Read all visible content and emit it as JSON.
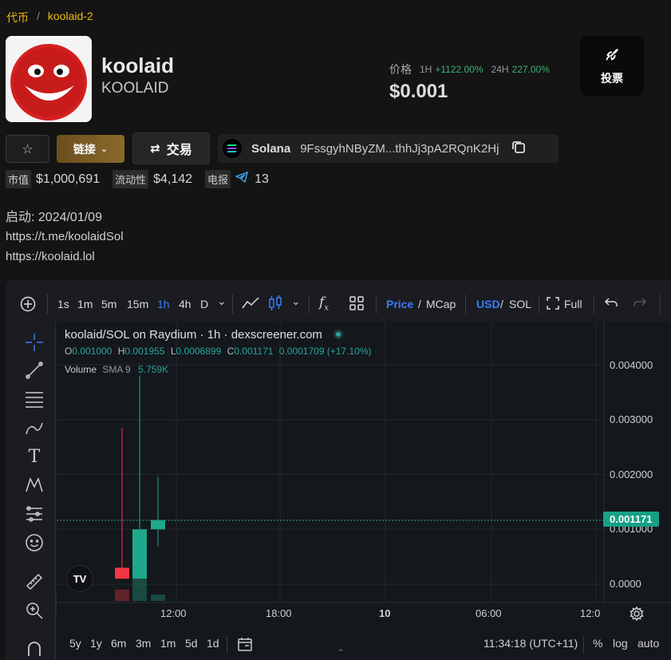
{
  "breadcrumb": {
    "root": "代币",
    "sep": "/",
    "current": "koolaid-2"
  },
  "token": {
    "name": "koolaid",
    "symbol": "KOOLAID"
  },
  "price": {
    "label": "价格",
    "h1_label": "1H",
    "h1_change": "+1122.00%",
    "h24_label": "24H",
    "h24_change": "227.00%",
    "value": "$0.001"
  },
  "vote": {
    "label": "投票",
    "icon": "rocket-icon"
  },
  "actions": {
    "link_label": "链接",
    "trade_label": "交易"
  },
  "chain": {
    "name": "Solana",
    "address": "9FssgyhNByZM...thhJj3pA2RQnK2Hj"
  },
  "stats": {
    "mcap_tag": "市值",
    "mcap": "$1,000,691",
    "liq_tag": "流动性",
    "liq": "$4,142",
    "tg_tag": "电报",
    "tg": "13"
  },
  "launch": "启动: 2024/01/09",
  "links": [
    "https://t.me/koolaidSol",
    "https://koolaid.lol"
  ],
  "toolbar": {
    "intervals": [
      "1s",
      "1m",
      "5m",
      "15m",
      "1h",
      "4h",
      "D"
    ],
    "active_interval": "1h",
    "price_label": "Price",
    "mcap_label": "MCap",
    "slash": "/",
    "usd_label": "USD",
    "sol_label": "SOL",
    "full_label": "Full"
  },
  "chart_legend": {
    "title": "koolaid/SOL on Raydium · 1h · dexscreener.com",
    "o_label": "O",
    "o": "0.001000",
    "h_label": "H",
    "h": "0.001955",
    "l_label": "L",
    "l": "0.0006899",
    "c_label": "C",
    "c": "0.001171",
    "change": "0.0001709 (+17.10%)",
    "volume_label": "Volume",
    "sma_label": "SMA 9",
    "volume_value": "5.759K"
  },
  "current_price_tag": "0.001171",
  "bottom": {
    "ranges": [
      "5y",
      "1y",
      "6m",
      "3m",
      "1m",
      "5d",
      "1d"
    ],
    "time": "11:34:18 (UTC+11)",
    "pct": "%",
    "log": "log",
    "auto": "auto"
  },
  "chart_data": {
    "type": "candlestick",
    "y_ticks": [
      "0.004000",
      "0.003000",
      "0.002000",
      "0.001000",
      "0.0000"
    ],
    "x_ticks": [
      "12:00",
      "18:00",
      "10",
      "06:00",
      "12:0"
    ],
    "candles": [
      {
        "open": 0.0003,
        "high": 0.00285,
        "low": 0.0003,
        "close": 0.0001,
        "dir": "down"
      },
      {
        "open": 0.0001,
        "high": 0.0038,
        "low": 0.0001,
        "close": 0.001,
        "dir": "up"
      },
      {
        "open": 0.001,
        "high": 0.00196,
        "low": 0.00069,
        "close": 0.00117,
        "dir": "up"
      }
    ],
    "volumes": [
      {
        "value": 0.18,
        "dir": "down"
      },
      {
        "value": 0.4,
        "dir": "up"
      },
      {
        "value": 0.1,
        "dir": "up"
      }
    ],
    "colors": {
      "up": "#1fa88a",
      "down": "#f23645"
    }
  }
}
